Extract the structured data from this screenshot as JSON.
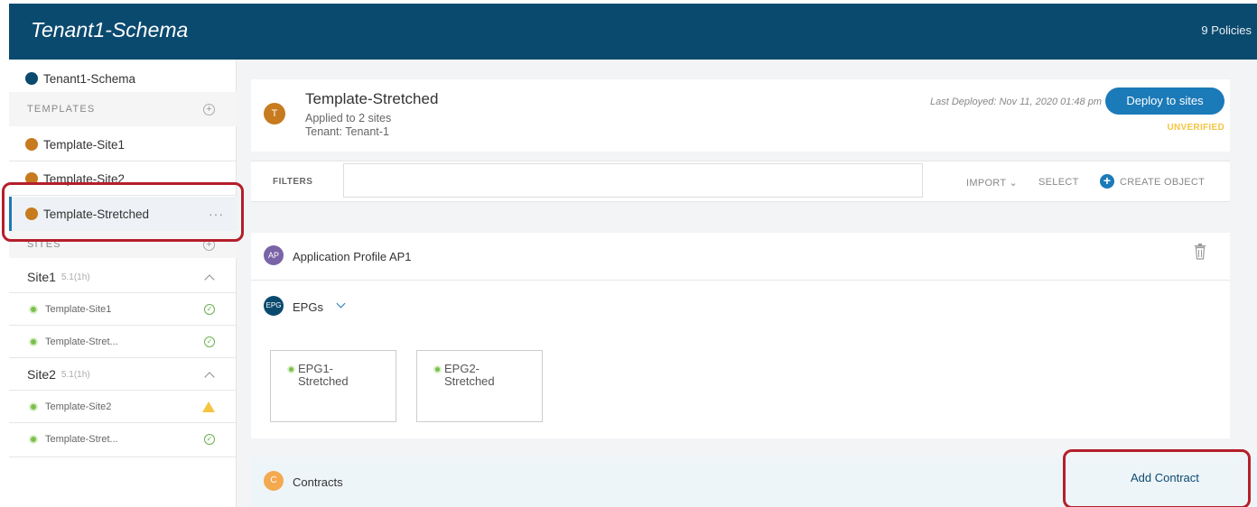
{
  "header": {
    "title": "Tenant1-Schema",
    "policies": "9 Policies"
  },
  "sidebar": {
    "schema_name": "Tenant1-Schema",
    "templates_heading": "TEMPLATES",
    "templates": [
      "Template-Site1",
      "Template-Site2",
      "Template-Stretched"
    ],
    "selected_more": "···",
    "sites_heading": "SITES",
    "sites": [
      {
        "name": "Site1",
        "version": "5.1(1h)",
        "templates": [
          {
            "label": "Template-Site1",
            "status": "ok"
          },
          {
            "label": "Template-Stret...",
            "status": "ok"
          }
        ]
      },
      {
        "name": "Site2",
        "version": "5.1(1h)",
        "templates": [
          {
            "label": "Template-Site2",
            "status": "warning"
          },
          {
            "label": "Template-Stret...",
            "status": "ok"
          }
        ]
      }
    ]
  },
  "template": {
    "avatar": "T",
    "title": "Template-Stretched",
    "applied": "Applied to 2 sites",
    "tenant": "Tenant: Tenant-1",
    "last_deployed": "Last Deployed: Nov 11, 2020 01:48 pm",
    "deploy_label": "Deploy to sites",
    "status": "UNVERIFIED"
  },
  "toolbar": {
    "filters_label": "FILTERS",
    "import": "IMPORT",
    "select": "SELECT",
    "create": "CREATE OBJECT"
  },
  "app_profile": {
    "avatar": "AP",
    "title": "Application Profile AP1"
  },
  "epgs": {
    "avatar": "EPG",
    "title": "EPGs",
    "items": [
      "EPG1-Stretched",
      "EPG2-Stretched"
    ]
  },
  "contracts": {
    "avatar": "C",
    "title": "Contracts",
    "add_label": "Add Contract"
  },
  "colors": {
    "header": "#0b4a6f",
    "accent": "#1b7ab8",
    "highlight": "#b41f2a",
    "warning": "#f5c542",
    "ok": "#6ab04c"
  }
}
